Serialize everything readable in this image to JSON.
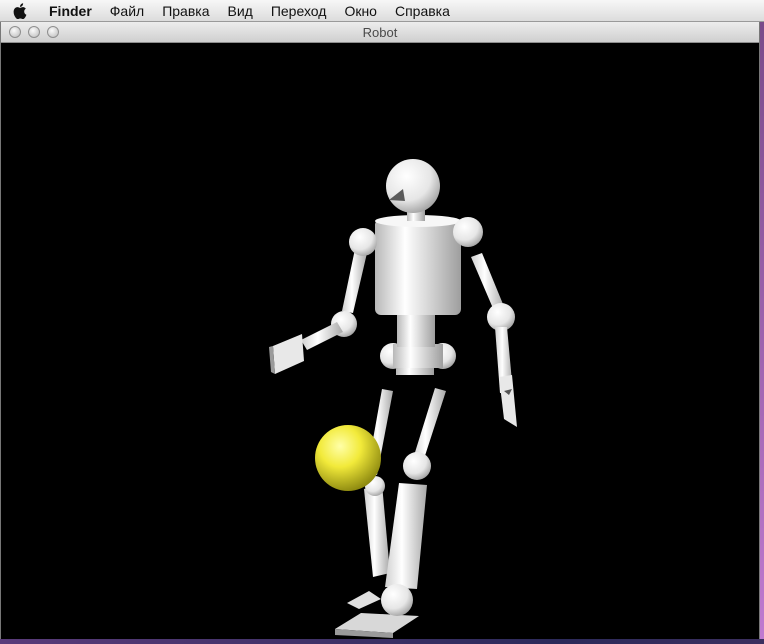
{
  "menubar": {
    "apple_icon": "apple-icon",
    "items": [
      {
        "label": "Finder",
        "bold": true
      },
      {
        "label": "Файл"
      },
      {
        "label": "Правка"
      },
      {
        "label": "Вид"
      },
      {
        "label": "Переход"
      },
      {
        "label": "Окно"
      },
      {
        "label": "Справка"
      }
    ]
  },
  "window": {
    "title": "Robot"
  },
  "scene": {
    "background": "#000000",
    "ball_color": "#f2ea3a",
    "robot_color": "#f4f4f4"
  }
}
